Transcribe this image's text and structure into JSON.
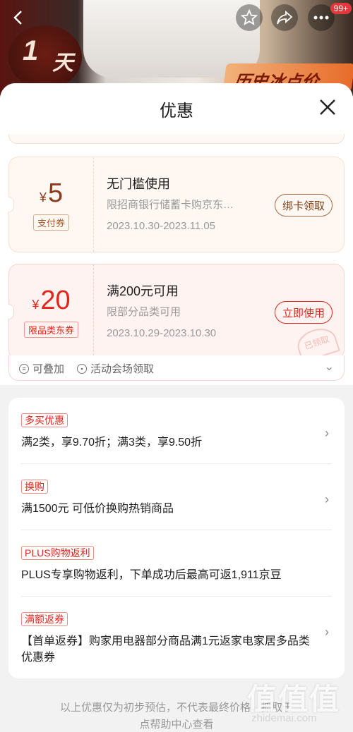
{
  "product_bg": {
    "day_badge_num": "1",
    "day_badge_unit": "天",
    "price_banner": "历史冰点价",
    "cart_count": "99+"
  },
  "sheet": {
    "title": "优惠"
  },
  "coupons": [
    {
      "currency": "¥",
      "amount": "5",
      "tag": "支付券",
      "title": "无门槛使用",
      "desc": "限招商银行储蓄卡购京东…",
      "date": "2023.10.30-2023.11.05",
      "button": "绑卡领取"
    },
    {
      "currency": "¥",
      "amount": "20",
      "tag": "限品类东券",
      "title": "满200元可用",
      "desc": "限部分品类可用",
      "date": "2023.10.29-2023.10.30",
      "button": "立即使用",
      "stamp": "已领取"
    }
  ],
  "coupon_footer": {
    "stackable": "可叠加",
    "venue": "活动会场领取"
  },
  "promotions": [
    {
      "tag": "多买优惠",
      "text": "满2类，享9.70折；满3类，享9.50折"
    },
    {
      "tag": "换购",
      "text": "满1500元 可低价换购热销商品"
    },
    {
      "tag": "PLUS购物返利",
      "text": "PLUS专享购物返利，下单成功后最高可返1,911京豆"
    },
    {
      "tag": "满额返券",
      "text": "【首单返券】购家用电器部分商品满1元返家电家居多品类优惠券"
    }
  ],
  "disclaimer": {
    "line1": "以上优惠仅为初步预估，不代表最终价格，抓取于",
    "line2": "点帮助中心查看"
  },
  "watermark": {
    "text": "值值值",
    "url": "zhidemai.com"
  }
}
